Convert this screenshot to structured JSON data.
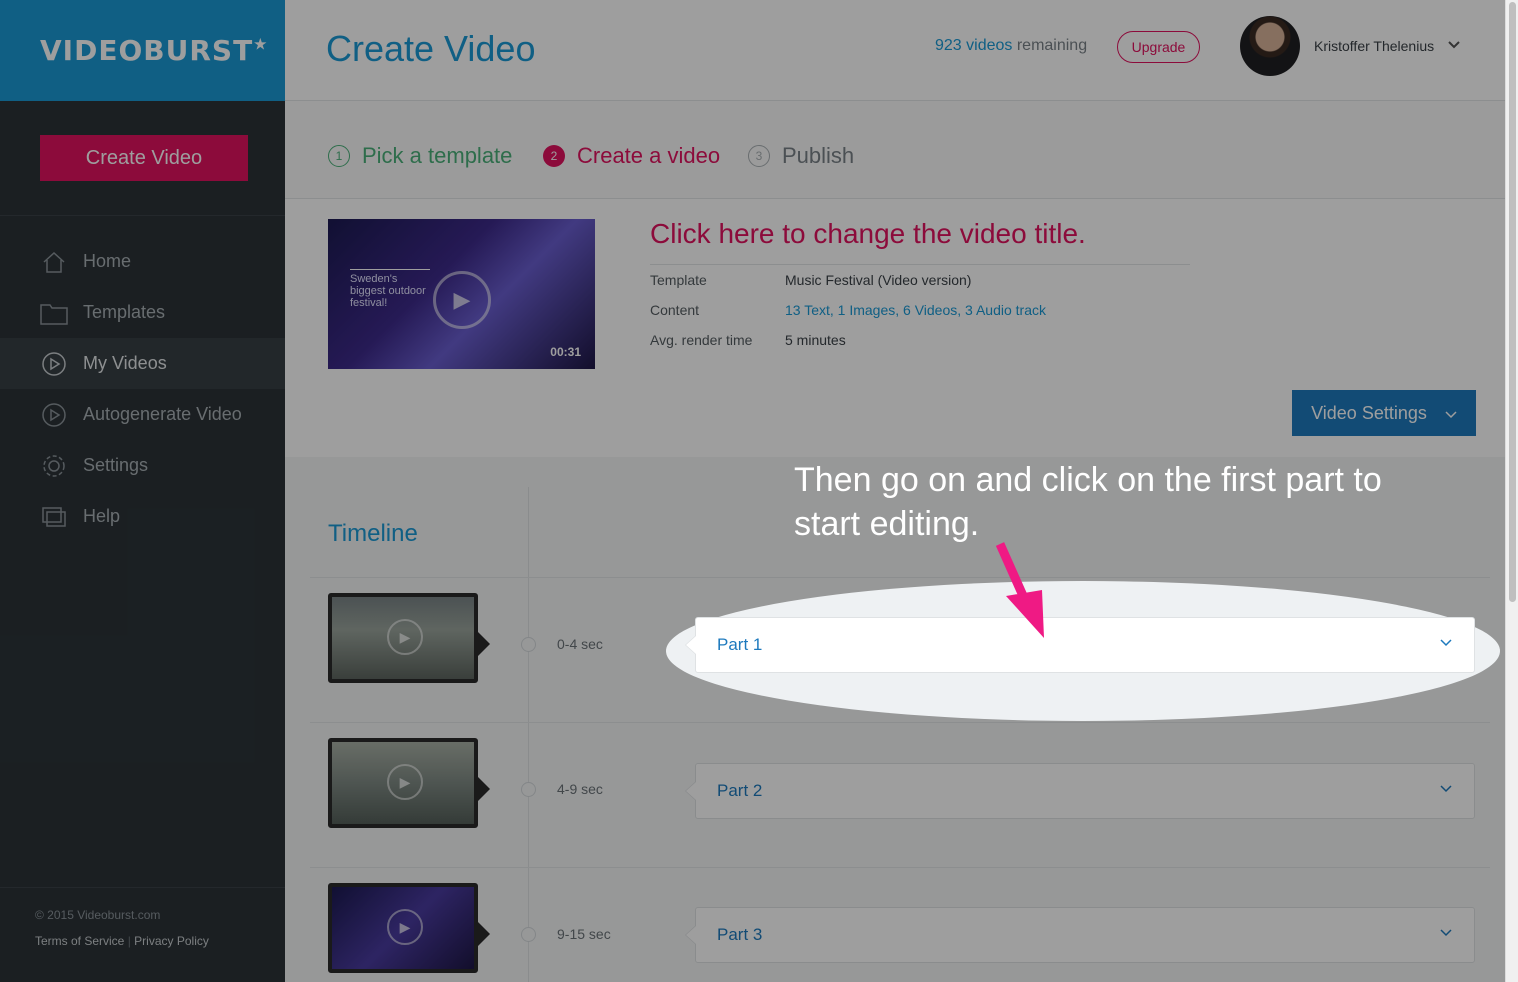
{
  "sidebar": {
    "logo": "VIDEOBURST",
    "create_button": "Create Video",
    "items": [
      {
        "label": "Home"
      },
      {
        "label": "Templates"
      },
      {
        "label": "My Videos"
      },
      {
        "label": "Autogenerate Video"
      },
      {
        "label": "Settings"
      },
      {
        "label": "Help"
      }
    ],
    "copyright": "© 2015 Videoburst.com",
    "terms": "Terms of Service",
    "separator": "|",
    "privacy": "Privacy Policy"
  },
  "header": {
    "title": "Create Video",
    "videos_count": "923 videos",
    "remaining": "remaining",
    "upgrade": "Upgrade",
    "user_name": "Kristoffer Thelenius"
  },
  "steps": [
    {
      "num": "1",
      "label": "Pick a template"
    },
    {
      "num": "2",
      "label": "Create a video"
    },
    {
      "num": "3",
      "label": "Publish"
    }
  ],
  "video": {
    "thumb_text": "Sweden's biggest outdoor festival!",
    "duration": "00:31",
    "title": "Click here to change the video title.",
    "template_label": "Template",
    "template_value": "Music Festival (Video version)",
    "content_label": "Content",
    "content_value": "13 Text, 1 Images, 6 Videos, 3 Audio track",
    "render_label": "Avg. render time",
    "render_value": "5 minutes",
    "settings_button": "Video Settings"
  },
  "timeline": {
    "title": "Timeline",
    "parts": [
      {
        "time": "0-4 sec",
        "label": "Part 1"
      },
      {
        "time": "4-9 sec",
        "label": "Part 2"
      },
      {
        "time": "9-15 sec",
        "label": "Part 3"
      }
    ]
  },
  "annotation": "Then go on and click on the first part to start editing.",
  "colors": {
    "brand_blue": "#1a9ad6",
    "accent_pink": "#e2135f",
    "button_blue": "#1d79bd",
    "step_done_green": "#4bb17a",
    "sidebar_bg": "#2c3338"
  }
}
